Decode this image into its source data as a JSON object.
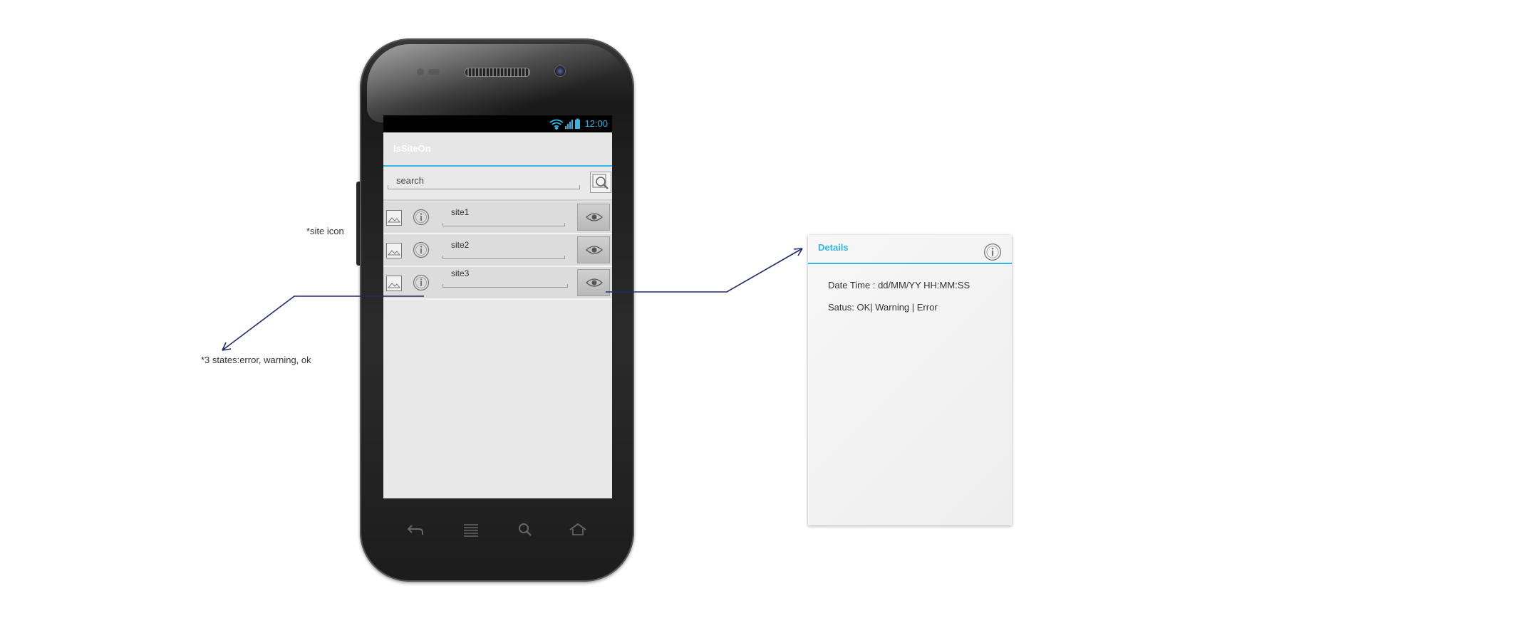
{
  "phone": {
    "status_time": "12:00",
    "app_title": "IsSiteOn",
    "search_placeholder": "search",
    "sites": [
      {
        "label": "site1"
      },
      {
        "label": "site2"
      },
      {
        "label": "site3"
      }
    ]
  },
  "details": {
    "title": "Details",
    "datetime": "Date Time : dd/MM/YY HH:MM:SS",
    "status": "Satus: OK| Warning | Error"
  },
  "notes": {
    "site_icon": "*site icon",
    "states": "*3 states:error, warning, ok"
  },
  "colors": {
    "accent": "#33b5e5",
    "arrow": "#1f2a6b"
  },
  "icons": [
    "wifi-icon",
    "signal-icon",
    "battery-icon",
    "search-icon",
    "image-icon",
    "info-icon",
    "eye-icon",
    "back-icon",
    "menu-icon",
    "search-nav-icon",
    "home-icon"
  ]
}
